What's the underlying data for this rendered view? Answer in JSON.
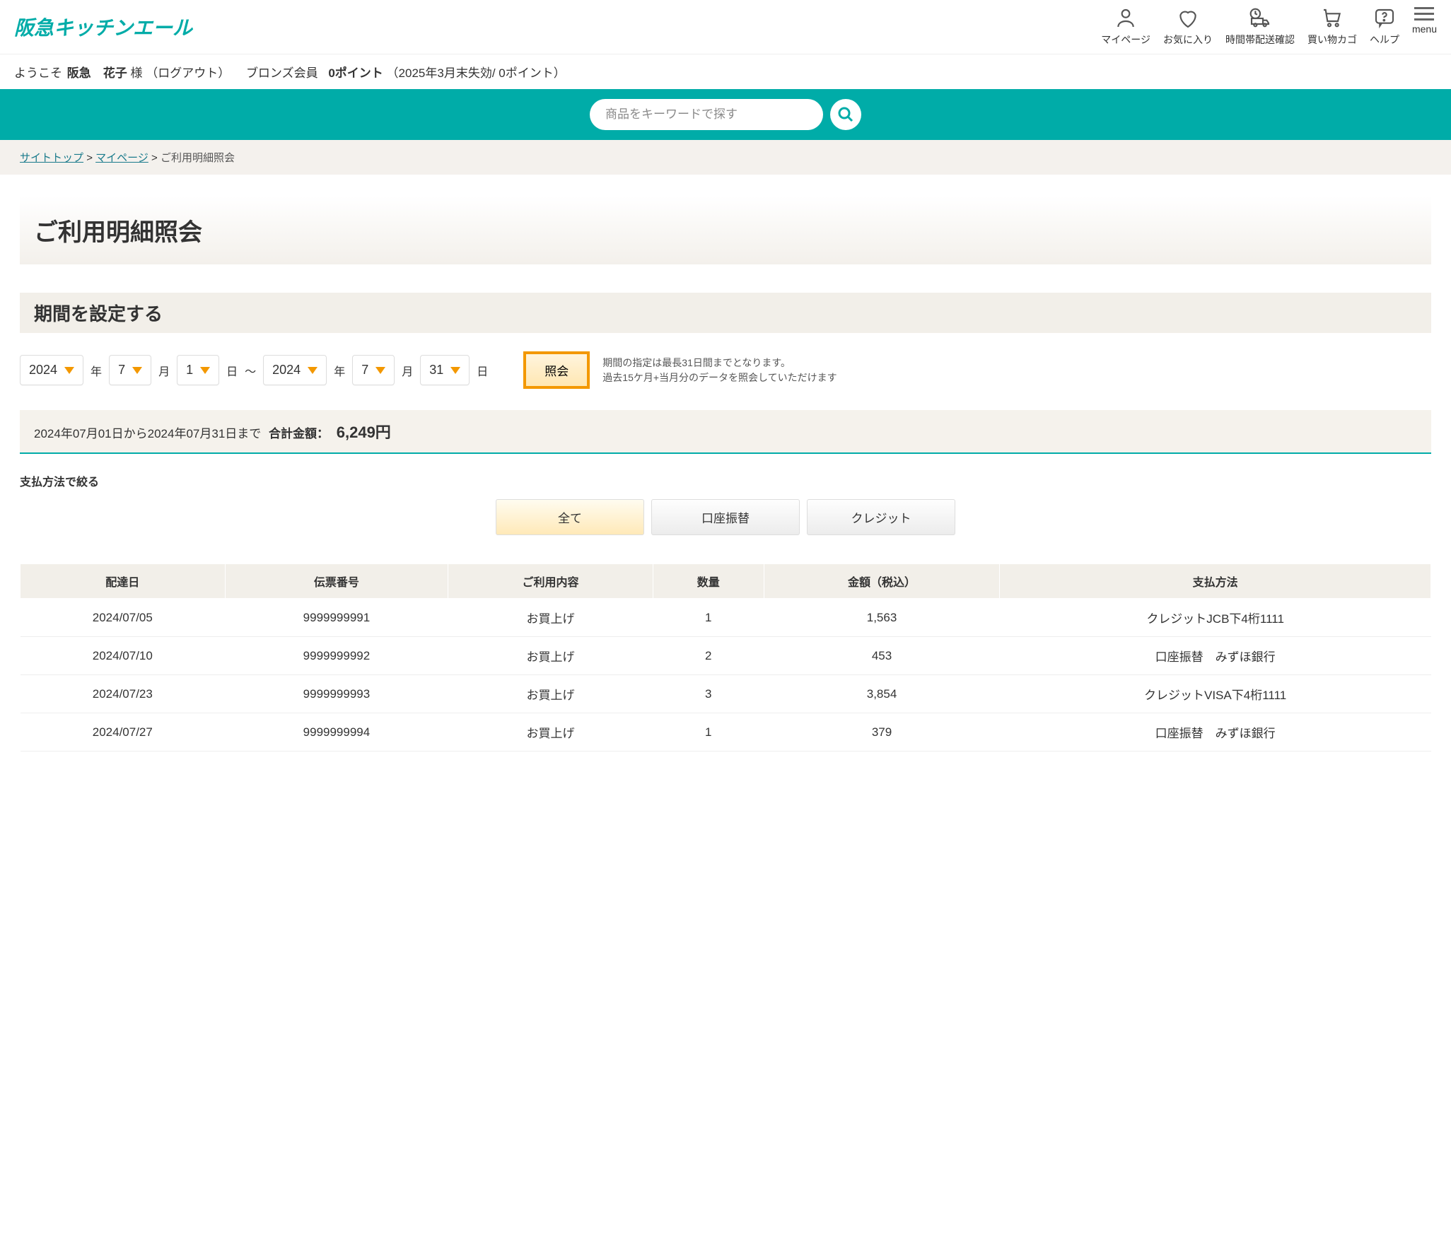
{
  "header": {
    "logo": "阪急キッチンエール",
    "items": [
      {
        "name": "mypage",
        "label": "マイページ"
      },
      {
        "name": "favorites",
        "label": "お気に入り"
      },
      {
        "name": "delivery",
        "label": "時間帯配送確認"
      },
      {
        "name": "cart",
        "label": "買い物カゴ"
      },
      {
        "name": "help",
        "label": "ヘルプ"
      },
      {
        "name": "menu",
        "label": "menu"
      }
    ]
  },
  "greeting": {
    "prefix": "ようこそ",
    "name": "阪急　花子",
    "suffix": "様",
    "logout": "（ログアウト）",
    "rank": "ブロンズ会員",
    "points": "0ポイント",
    "points_note": "（2025年3月末失効/ 0ポイント）"
  },
  "search": {
    "placeholder": "商品をキーワードで探す"
  },
  "breadcrumb": {
    "top": "サイトトップ",
    "mypage": "マイページ",
    "current": "ご利用明細照会"
  },
  "page_title": "ご利用明細照会",
  "period": {
    "title": "期間を設定する",
    "from_year": "2024",
    "from_month": "7",
    "from_day": "1",
    "to_year": "2024",
    "to_month": "7",
    "to_day": "31",
    "year_u": "年",
    "month_u": "月",
    "day_u": "日",
    "sep": "～",
    "lookup": "照会",
    "note1": "期間の指定は最長31日間までとなります。",
    "note2": "過去15ケ月+当月分のデータを照会していただけます"
  },
  "summary": {
    "range_text": "2024年07月01日から2024年07月31日まで",
    "total_label": "合計金額：",
    "total_value": "6,249円"
  },
  "filter": {
    "label": "支払方法で絞る",
    "all": "全て",
    "bank": "口座振替",
    "credit": "クレジット"
  },
  "table": {
    "headers": [
      "配達日",
      "伝票番号",
      "ご利用内容",
      "数量",
      "金額（税込）",
      "支払方法"
    ],
    "rows": [
      [
        "2024/07/05",
        "9999999991",
        "お買上げ",
        "1",
        "1,563",
        "クレジットJCB下4桁1111"
      ],
      [
        "2024/07/10",
        "9999999992",
        "お買上げ",
        "2",
        "453",
        "口座振替　みずほ銀行"
      ],
      [
        "2024/07/23",
        "9999999993",
        "お買上げ",
        "3",
        "3,854",
        "クレジットVISA下4桁1111"
      ],
      [
        "2024/07/27",
        "9999999994",
        "お買上げ",
        "1",
        "379",
        "口座振替　みずほ銀行"
      ]
    ]
  }
}
